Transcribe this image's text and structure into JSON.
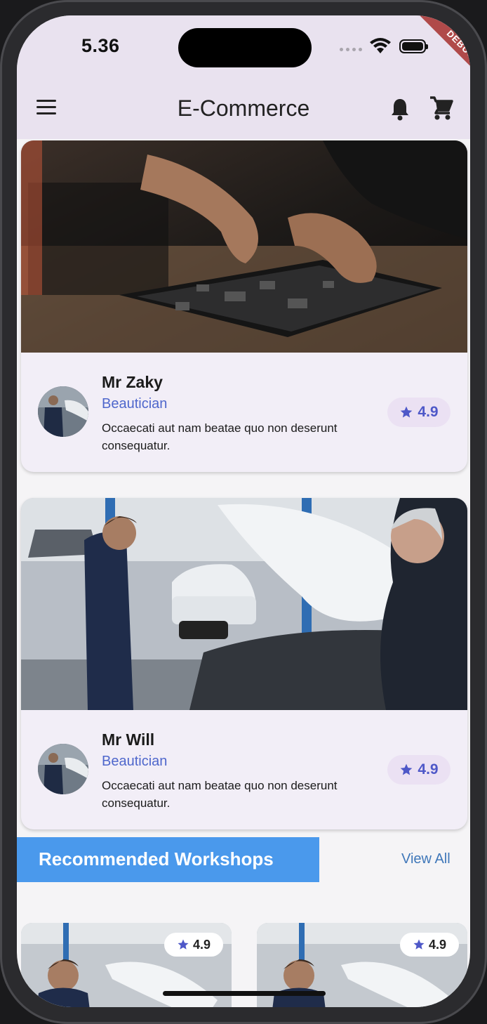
{
  "status_bar": {
    "time": "5.36",
    "debug_label": "DEBUG"
  },
  "app_bar": {
    "title": "E-Commerce"
  },
  "cards": [
    {
      "name": "Mr Zaky",
      "role": "Beautician",
      "description": "Occaecati aut nam beatae quo non deserunt consequatur.",
      "rating": "4.9"
    },
    {
      "name": "Mr Will",
      "role": "Beautician",
      "description": "Occaecati aut nam beatae quo non deserunt consequatur.",
      "rating": "4.9"
    }
  ],
  "section": {
    "title": "Recommended Workshops",
    "view_all": "View All"
  },
  "workshops": [
    {
      "rating": "4.9"
    },
    {
      "rating": "4.9"
    }
  ],
  "colors": {
    "accent": "#4a99ec",
    "star": "#4e58c8",
    "appbar": "#e9e2ef"
  }
}
